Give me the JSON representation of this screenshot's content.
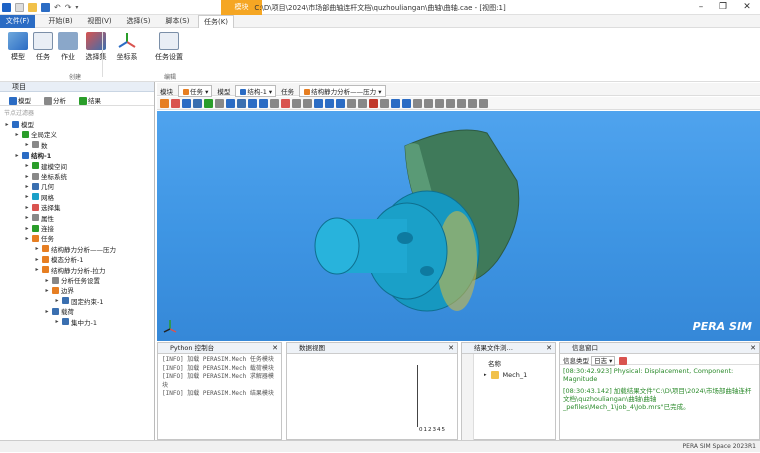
{
  "window": {
    "title": "C:\\D\\项目\\2024\\市场部曲轴连杆文档\\quzhouliangan\\曲轴\\曲轴.cae - [视图:1]",
    "context_tab": "模块"
  },
  "menu": [
    "文件(F)",
    "开始(B)",
    "视图(V)",
    "选择(S)",
    "脚本(S)",
    "任务(K)"
  ],
  "ribbon": {
    "buttons": [
      "模型",
      "任务",
      "作业",
      "选择集",
      "坐标系",
      "任务设置"
    ],
    "groups": [
      "创建",
      "编辑"
    ]
  },
  "tree": {
    "title": "项目",
    "tabs": [
      "模型",
      "分析",
      "结果"
    ],
    "filter_placeholder": "节点过滤器",
    "nodes": [
      {
        "label": "模型",
        "depth": 0
      },
      {
        "label": "全局定义",
        "depth": 1
      },
      {
        "label": "数",
        "depth": 2
      },
      {
        "label": "结构-1",
        "depth": 1
      },
      {
        "label": "建模空间",
        "depth": 2
      },
      {
        "label": "坐标系统",
        "depth": 2
      },
      {
        "label": "几何",
        "depth": 2
      },
      {
        "label": "网格",
        "depth": 2
      },
      {
        "label": "选择集",
        "depth": 2
      },
      {
        "label": "属性",
        "depth": 2
      },
      {
        "label": "连接",
        "depth": 2
      },
      {
        "label": "任务",
        "depth": 2
      },
      {
        "label": "结构静力分析——压力",
        "depth": 3
      },
      {
        "label": "模态分析-1",
        "depth": 3
      },
      {
        "label": "结构静力分析-拉力",
        "depth": 3
      },
      {
        "label": "分析任务设置",
        "depth": 4
      },
      {
        "label": "边界",
        "depth": 4
      },
      {
        "label": "固定约束-1",
        "depth": 5
      },
      {
        "label": "载荷",
        "depth": 4
      },
      {
        "label": "集中力-1",
        "depth": 5
      }
    ]
  },
  "view_toolbar": {
    "items": [
      "模块",
      "任务",
      "模型",
      "结构-1",
      "任务",
      "结构静力分析——压力"
    ]
  },
  "viewport": {
    "logo": "PERA SIM"
  },
  "python_console": {
    "title": "Python 控制台",
    "lines": [
      "[INFO] 加载 PERASIM.Mech 任务模块",
      "[INFO] 加载 PERASIM.Mech 载荷模块",
      "[INFO] 加载 PERASIM.Mech 求解器模块",
      "[INFO] 加载 PERASIM.Mech 结果模块"
    ]
  },
  "data_view": {
    "title": "数据视图",
    "ticks": [
      "0",
      "1",
      "2",
      "3",
      "4",
      "5"
    ]
  },
  "result_browser": {
    "title": "结果文件浏…",
    "column": "名称",
    "item": "Mech_1"
  },
  "info_window": {
    "title": "信息窗口",
    "filter_label": "信息类型",
    "filter_value": "日志",
    "lines": [
      "[08:30:42.923] Physical: Displacement, Component: Magnitude",
      "[08:30:43.142] 加载结果文件\"C:\\D\\项目\\2024\\市场部曲轴连杆文档\\quzhouliangan\\曲轴\\曲轴_pefiles\\Mech_1\\job_4\\Job.mrs\"已完成。"
    ]
  },
  "status": "PERA SIM Space 2023R1",
  "colors": {
    "accent": "#2b6cc4",
    "context": "#f5a623",
    "viewport": "#3f96e4",
    "part_green": "#3f7a5a",
    "part_cyan": "#1aa0c8"
  }
}
